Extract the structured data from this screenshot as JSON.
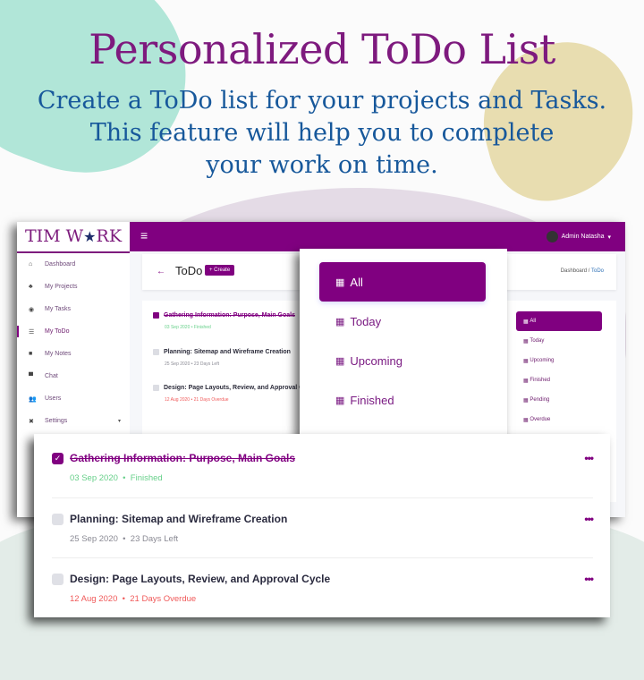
{
  "hero": {
    "title": "Personalized ToDo List",
    "subtitle_lines": [
      "Create a ToDo list for your projects and Tasks.",
      "This feature will help you to complete",
      "your work on time."
    ]
  },
  "app": {
    "logo": {
      "left": "TIM W",
      "star": "★",
      "right": "RK"
    },
    "topbar": {
      "menu_icon": "≡",
      "user_name": "Admin Natasha",
      "caret": "▾"
    },
    "sidebar": {
      "items": [
        {
          "icon": "home-icon",
          "glyph": "⌂",
          "label": "Dashboard"
        },
        {
          "icon": "projects-icon",
          "glyph": "♣",
          "label": "My Projects"
        },
        {
          "icon": "tasks-icon",
          "glyph": "◉",
          "label": "My Tasks"
        },
        {
          "icon": "list-icon",
          "glyph": "☰",
          "label": "My ToDo",
          "active": true
        },
        {
          "icon": "notes-icon",
          "glyph": "■",
          "label": "My Notes"
        },
        {
          "icon": "chat-icon",
          "glyph": "▀",
          "label": "Chat"
        },
        {
          "icon": "users-icon",
          "glyph": "👥",
          "label": "Users"
        },
        {
          "icon": "settings-icon",
          "glyph": "✖",
          "label": "Settings",
          "caret": "▾"
        }
      ]
    },
    "header": {
      "back_icon": "←",
      "title": "ToDo",
      "create_label": "+ Create",
      "breadcrumb": {
        "parent": "Dashboard",
        "separator": "/",
        "current": "ToDo"
      }
    },
    "filters": [
      {
        "label": "All",
        "active": true
      },
      {
        "label": "Today"
      },
      {
        "label": "Upcoming"
      },
      {
        "label": "Finished"
      },
      {
        "label": "Pending"
      },
      {
        "label": "Overdue"
      }
    ],
    "calendar_glyph": "▦",
    "tasks": [
      {
        "title": "Gathering Information: Purpose, Main Goals",
        "date": "03 Sep 2020",
        "status": "Finished",
        "checked": true,
        "tone": "green"
      },
      {
        "title": "Planning: Sitemap and Wireframe Creation",
        "date": "25 Sep 2020",
        "status": "23 Days Left",
        "checked": false,
        "tone": "gray"
      },
      {
        "title": "Design: Page Layouts, Review, and Approval Cycle",
        "date": "12 Aug 2020",
        "status": "21 Days Overdue",
        "checked": false,
        "tone": "red"
      }
    ],
    "bullet": "•",
    "more_icon": "•••",
    "check_glyph": "✓"
  },
  "colors": {
    "brand": "#800080",
    "title": "#7e1a7e",
    "subtitle": "#17589b",
    "finished": "#67d08a",
    "overdue": "#f05a5a"
  }
}
